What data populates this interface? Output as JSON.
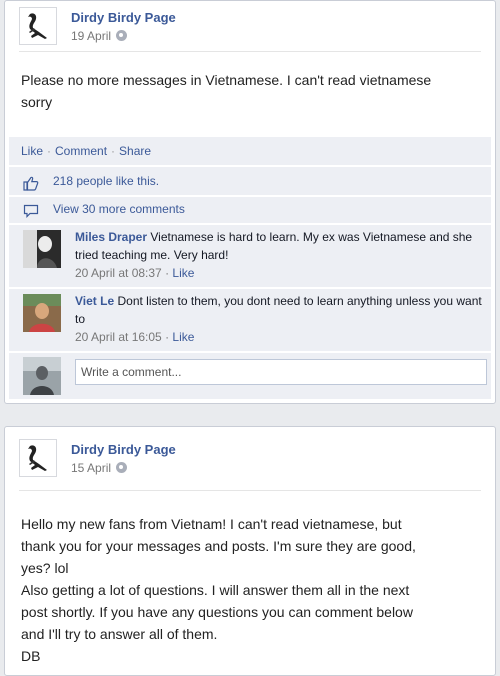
{
  "posts": [
    {
      "page_name": "Dirdy Birdy Page",
      "date": "19 April",
      "privacy_icon": "globe-icon",
      "body_lines": [
        "Please no more messages in Vietnamese. I can't read vietnamese",
        "sorry"
      ],
      "actions": {
        "like": "Like",
        "comment": "Comment",
        "share": "Share",
        "sep": "·"
      },
      "likes_text": "218 people like this.",
      "view_more": "View 30 more comments",
      "comments": [
        {
          "name": "Miles Draper",
          "text": "Vietnamese is hard to learn. My ex was Vietnamese and she tried teaching me. Very hard!",
          "time": "20 April at 08:37",
          "like": "Like"
        },
        {
          "name": "Viet Le",
          "text": "Dont listen to them, you dont need to learn anything unless you want to",
          "time": "20 April at 16:05",
          "like": "Like"
        }
      ],
      "write_placeholder": "Write a comment..."
    },
    {
      "page_name": "Dirdy Birdy Page",
      "date": "15 April",
      "privacy_icon": "globe-icon",
      "body_lines": [
        "Hello my new fans from Vietnam! I can't read vietnamese, but",
        "thank you for your messages and posts. I'm sure they are good,",
        "yes? lol",
        "Also getting a lot of questions. I will answer them all in the next",
        "post shortly. If you have any questions you can comment below",
        "and I'll try to answer all of them.",
        "DB"
      ]
    }
  ],
  "colors": {
    "link": "#3b5998",
    "ufi_bg": "#edeff4",
    "page_bg": "#e9ebee"
  }
}
